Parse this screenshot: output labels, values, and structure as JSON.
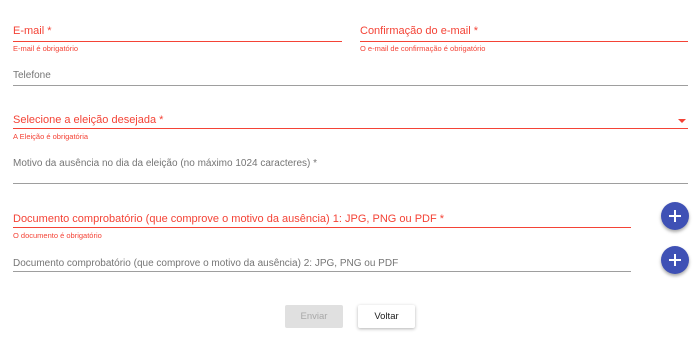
{
  "form": {
    "email": {
      "label": "E-mail *",
      "error": "E-mail é obrigatório"
    },
    "email_confirm": {
      "label": "Confirmação do e-mail *",
      "error": "O e-mail de confirmação é obrigatório"
    },
    "telefone": {
      "label": "Telefone"
    },
    "eleicao": {
      "label": "Selecione a eleição desejada *",
      "error": "A Eleição é obrigatória"
    },
    "motivo": {
      "label": "Motivo da ausência no dia da eleição (no máximo 1024 caracteres) *"
    },
    "documento1": {
      "label": "Documento comprobatório (que comprove o motivo da ausência) 1: JPG, PNG ou PDF *",
      "error": "O documento é obrigatório"
    },
    "documento2": {
      "label": "Documento comprobatório (que comprove o motivo da ausência) 2: JPG, PNG ou PDF"
    }
  },
  "actions": {
    "enviar_label": "Enviar",
    "voltar_label": "Voltar"
  },
  "icons": {
    "add_file": "plus-icon",
    "dropdown": "arrow-drop-down-icon"
  },
  "colors": {
    "error": "#f44336",
    "accent": "#3f51b5",
    "line": "#9e9e9e",
    "hint": "#757575",
    "disabled_bg": "#e0e0e0"
  }
}
